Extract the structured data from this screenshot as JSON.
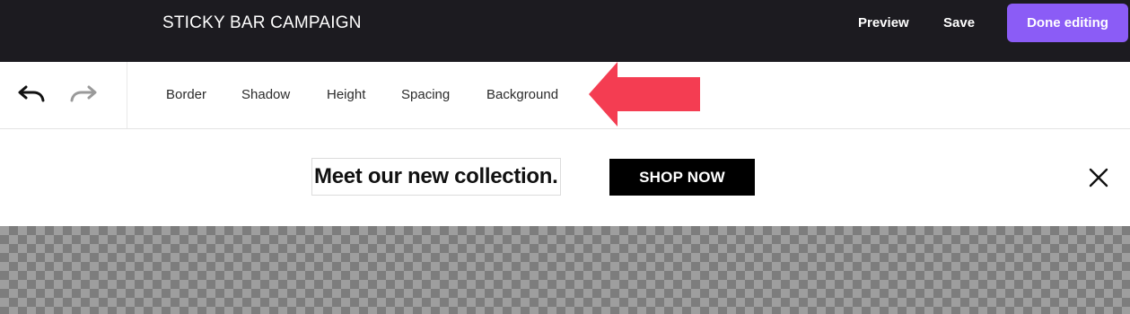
{
  "header": {
    "title": "STICKY BAR CAMPAIGN",
    "preview_label": "Preview",
    "save_label": "Save",
    "done_label": "Done editing",
    "accent_color": "#8b5cf6",
    "background_color": "#1c1b20"
  },
  "toolbar": {
    "history": [
      {
        "icon": "undo-icon"
      },
      {
        "icon": "redo-icon"
      }
    ],
    "tabs": [
      {
        "label": "Border"
      },
      {
        "label": "Shadow"
      },
      {
        "label": "Height"
      },
      {
        "label": "Spacing"
      },
      {
        "label": "Background"
      }
    ],
    "annotation": {
      "icon": "arrow-left-icon",
      "color": "#f43d52"
    }
  },
  "sticky_bar": {
    "message": "Meet our new collection.",
    "button_label": "SHOP NOW",
    "close_icon": "close-icon"
  },
  "canvas": {
    "background": "transparency-checkerboard"
  }
}
